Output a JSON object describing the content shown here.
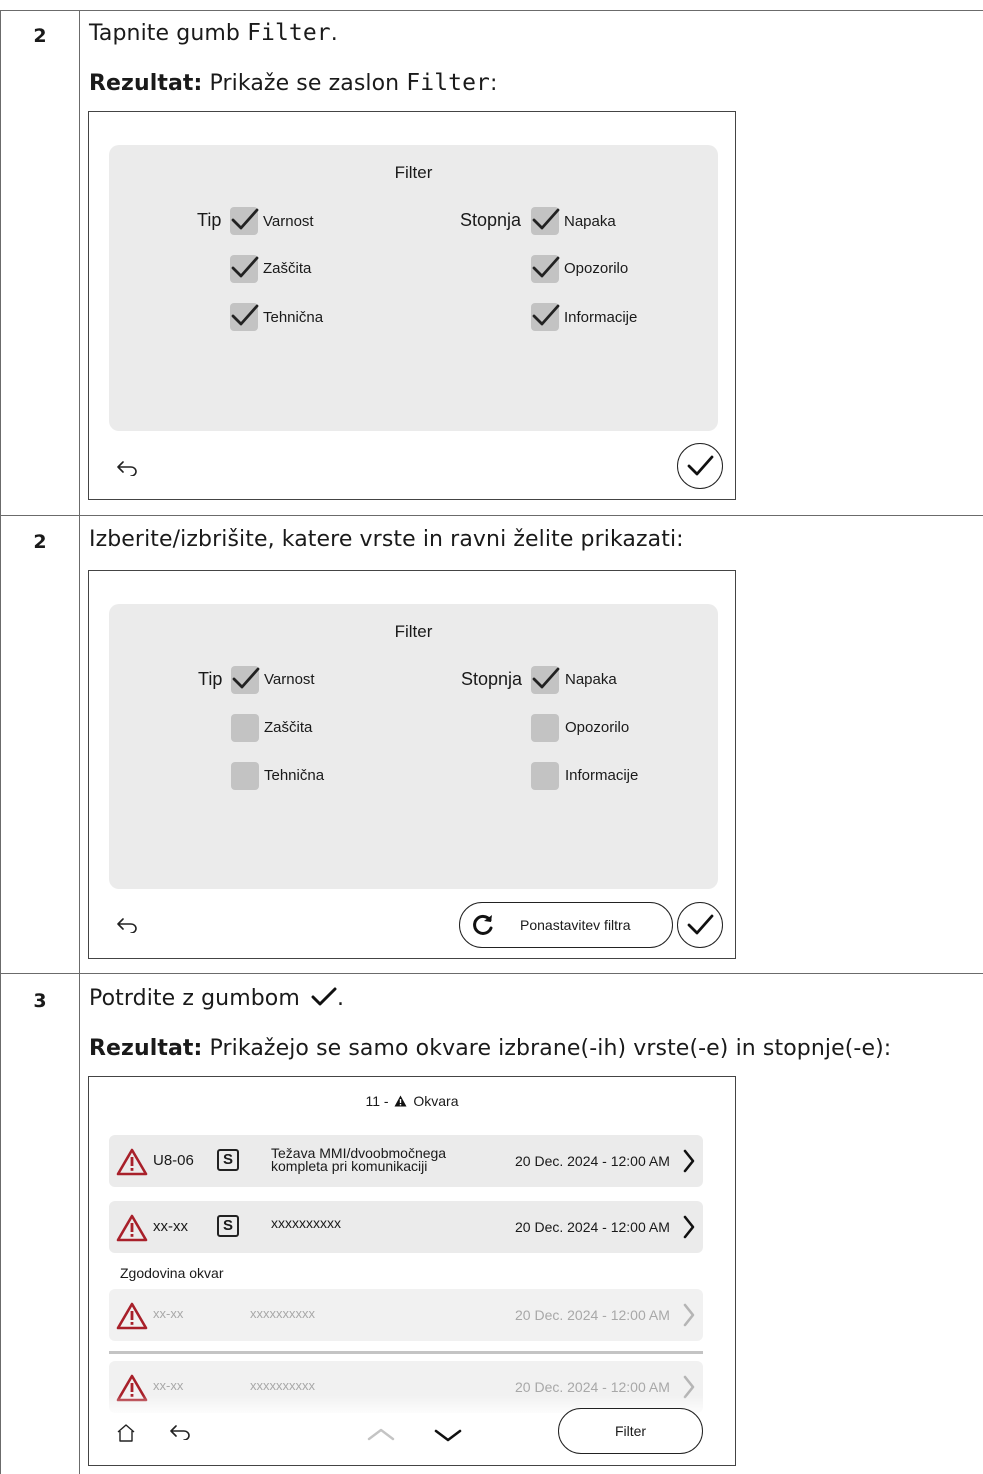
{
  "steps": [
    {
      "number": "2",
      "instruction_prefix": "Tapnite gumb",
      "instruction_code": "Filter",
      "instruction_suffix": ".",
      "result_label": "Rezultat:",
      "result_prefix": "Prikaže se zaslon",
      "result_code": "Filter",
      "result_suffix": ":",
      "screen": {
        "title": "Filter",
        "type_label": "Tip",
        "level_label": "Stopnja",
        "type_options": [
          {
            "label": "Varnost",
            "checked": true
          },
          {
            "label": "Zaščita",
            "checked": true
          },
          {
            "label": "Tehnična",
            "checked": true
          }
        ],
        "level_options": [
          {
            "label": "Napaka",
            "checked": true
          },
          {
            "label": "Opozorilo",
            "checked": true
          },
          {
            "label": "Informacije",
            "checked": true
          }
        ],
        "back_icon": "back-arrow-icon",
        "confirm_icon": "checkmark-icon"
      }
    },
    {
      "number": "2",
      "instruction": "Izberite/izbrišite, katere vrste in ravni želite prikazati:",
      "screen": {
        "title": "Filter",
        "type_label": "Tip",
        "level_label": "Stopnja",
        "type_options": [
          {
            "label": "Varnost",
            "checked": true
          },
          {
            "label": "Zaščita",
            "checked": false
          },
          {
            "label": "Tehnična",
            "checked": false
          }
        ],
        "level_options": [
          {
            "label": "Napaka",
            "checked": true
          },
          {
            "label": "Opozorilo",
            "checked": false
          },
          {
            "label": "Informacije",
            "checked": false
          }
        ],
        "reset_button_label": "Ponastavitev filtra",
        "reset_icon": "refresh-icon",
        "back_icon": "back-arrow-icon",
        "confirm_icon": "checkmark-icon"
      }
    },
    {
      "number": "3",
      "instruction_prefix": "Potrdite z gumbom",
      "instruction_suffix": ".",
      "result_label": "Rezultat:",
      "result_text": "Prikažejo se samo okvare izbrane(-ih) vrste(-e) in stopnje(-e):",
      "screen": {
        "header_count": "11 -",
        "header_title": "Okvara",
        "active_errors": [
          {
            "code": "U8-06",
            "type_badge": "S",
            "description_line1": "Težava MMI/dvoobmočnega",
            "description_line2": "kompleta pri komunikaciji",
            "date": "20 Dec. 2024 - 12:00 AM"
          },
          {
            "code": "xx-xx",
            "type_badge": "S",
            "description_line1": "xxxxxxxxxx",
            "description_line2": "",
            "date": "20 Dec. 2024 - 12:00 AM"
          }
        ],
        "history_label": "Zgodovina okvar",
        "history_errors": [
          {
            "code": "xx-xx",
            "description": "xxxxxxxxxx",
            "date": "20 Dec. 2024 - 12:00 AM"
          },
          {
            "code": "xx-xx",
            "description": "xxxxxxxxxx",
            "date": "20 Dec. 2024 - 12:00 AM"
          }
        ],
        "filter_button_label": "Filter",
        "home_icon": "home-icon",
        "back_icon": "back-arrow-icon",
        "up_icon": "chevron-up-icon",
        "down_icon": "chevron-down-icon"
      }
    }
  ],
  "colors": {
    "warning_red": "#a8202a",
    "panel_gray": "#ebebeb",
    "checkbox_gray": "#c3c3c3"
  }
}
